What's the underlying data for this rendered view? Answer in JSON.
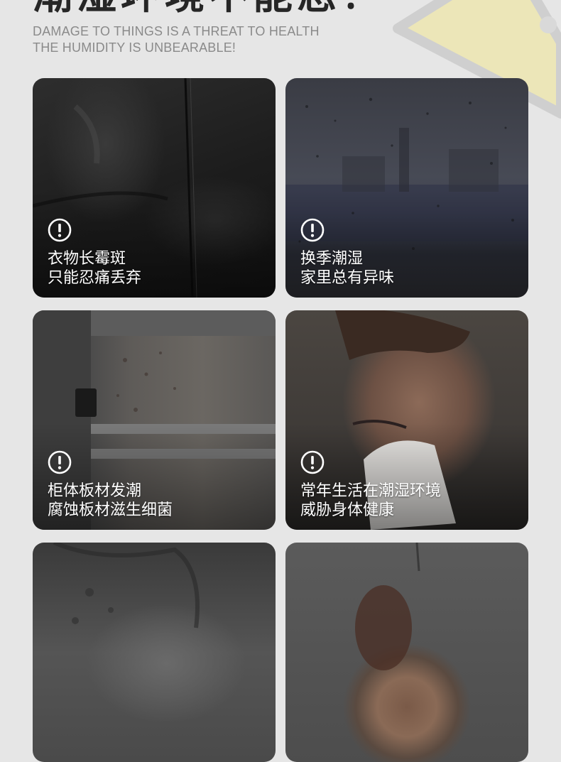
{
  "header": {
    "headline": "潮湿环境不能忍！",
    "subtitle_line1": "DAMAGE TO THINGS IS A THREAT TO HEALTH",
    "subtitle_line2": "THE HUMIDITY IS UNBEARABLE!"
  },
  "cards": [
    {
      "photo": "moldy-black-jacket",
      "icon": "warning-icon",
      "line1": "衣物长霉斑",
      "line2": "只能忍痛丢弃"
    },
    {
      "photo": "rain-on-window",
      "icon": "warning-icon",
      "line1": "换季潮湿",
      "line2": "家里总有异味"
    },
    {
      "photo": "moldy-cabinet",
      "icon": "warning-icon",
      "line1": "柜体板材发潮",
      "line2": "腐蚀板材滋生细菌"
    },
    {
      "photo": "man-sneezing-tissue",
      "icon": "warning-icon",
      "line1": "常年生活在潮湿环境",
      "line2": "威胁身体健康"
    },
    {
      "photo": "moldy-shirt",
      "icon": "warning-icon"
    },
    {
      "photo": "moldy-apple",
      "icon": "warning-icon"
    }
  ],
  "colors": {
    "background": "#e6e6e6",
    "headline": "#262626",
    "subtitle": "#8a8a8a",
    "caption": "#ffffff",
    "decoration": "#ece6b8"
  }
}
